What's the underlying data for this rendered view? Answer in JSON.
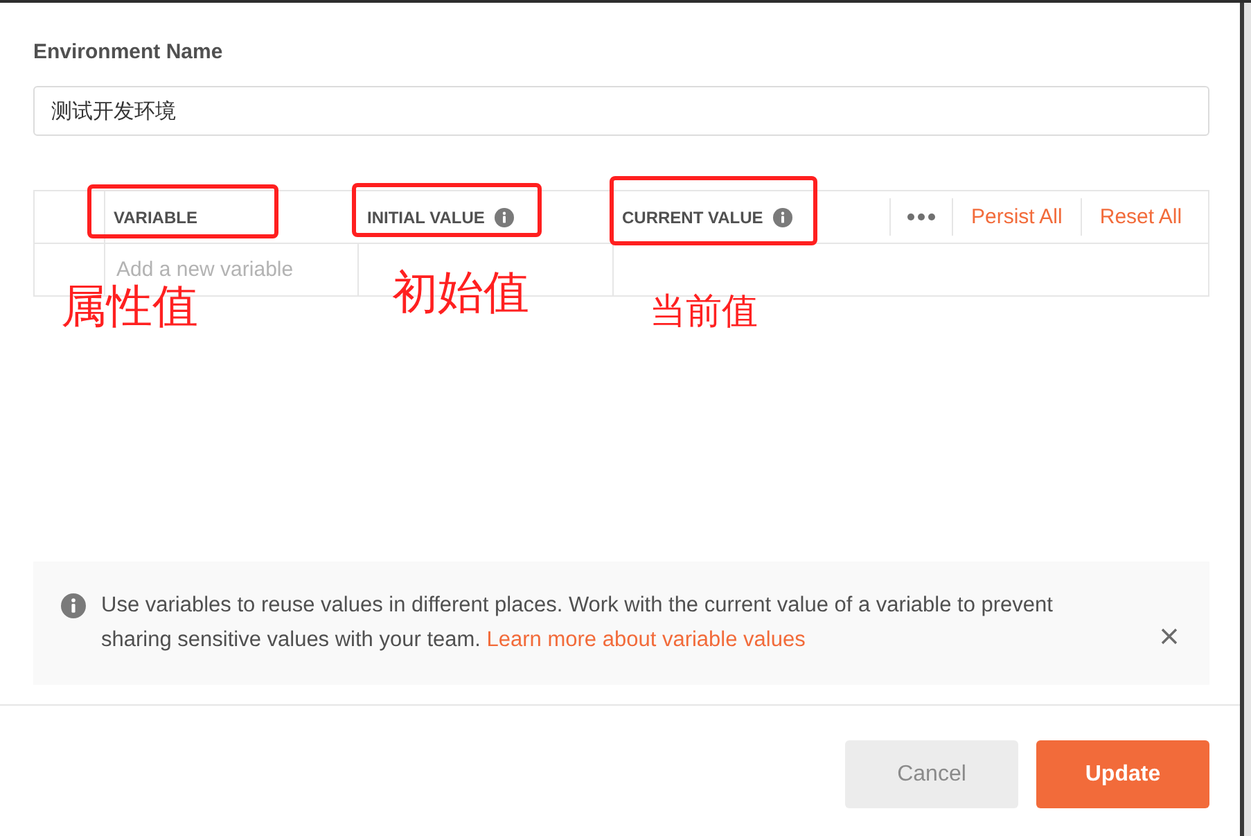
{
  "environment_name": {
    "label": "Environment Name",
    "value": "测试开发环境"
  },
  "table": {
    "columns": [
      {
        "label": "VARIABLE",
        "info": false,
        "highlighted": true,
        "note": "属性值"
      },
      {
        "label": "INITIAL VALUE",
        "info": true,
        "highlighted": true,
        "note": "初始值"
      },
      {
        "label": "CURRENT VALUE",
        "info": true,
        "highlighted": true,
        "note": "当前值"
      }
    ],
    "actions": [
      "Persist All",
      "Reset All"
    ],
    "new_row": {
      "placeholder": "Add a new variable"
    }
  },
  "notice": {
    "text": "Use variables to reuse values in different places. Work with the current value of a variable to prevent sharing sensitive values with your team.",
    "link": "Learn more about variable values"
  },
  "buttons": [
    {
      "label": "Cancel",
      "kind": "secondary"
    },
    {
      "label": "Update",
      "kind": "primary"
    }
  ]
}
